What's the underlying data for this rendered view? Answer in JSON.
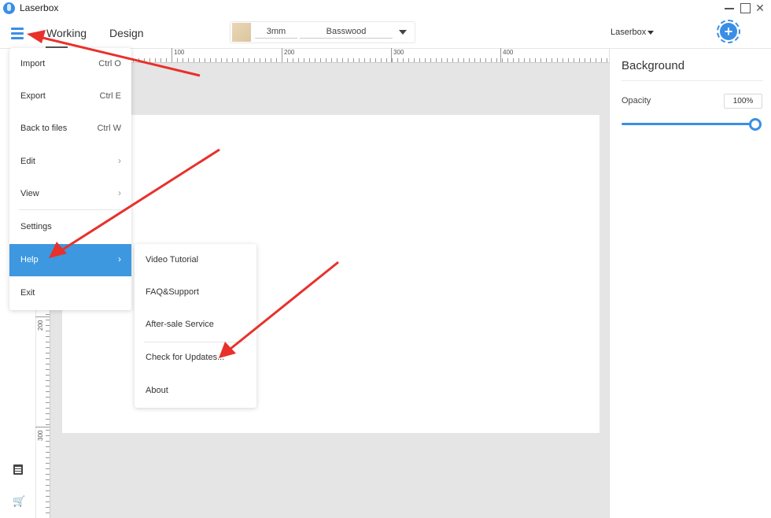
{
  "window": {
    "title": "Laserbox",
    "close_glyph": "✕"
  },
  "toolbar": {
    "menu_icon": "hamburger-menu-icon",
    "tabs": [
      {
        "label": "Working",
        "active": true
      },
      {
        "label": "Design",
        "active": false
      }
    ],
    "material": {
      "thickness": "3mm",
      "name": "Basswood"
    },
    "device": "Laserbox",
    "connect_icon": "plus-icon",
    "connect_glyph": "+"
  },
  "rulers": {
    "top_labels": [
      "100",
      "200",
      "300",
      "400"
    ],
    "left_labels": [
      "200",
      "300"
    ]
  },
  "sidebar": {
    "icons": [
      "note-icon",
      "cart-icon"
    ],
    "cart_glyph": "🛒"
  },
  "right_panel": {
    "title": "Background",
    "opacity_label": "Opacity",
    "opacity_value": "100%",
    "opacity_level": 1.0
  },
  "main_menu": {
    "items": [
      {
        "label": "Import",
        "shortcut": "Ctrl O"
      },
      {
        "label": "Export",
        "shortcut": "Ctrl E"
      },
      {
        "label": "Back to files",
        "shortcut": "Ctrl W"
      },
      {
        "label": "Edit",
        "arrow": "›"
      },
      {
        "label": "View",
        "arrow": "›"
      },
      {
        "label": "Settings"
      },
      {
        "label": "Help",
        "arrow": "›",
        "active": true
      },
      {
        "label": "Exit"
      }
    ]
  },
  "help_submenu": {
    "items": [
      {
        "label": "Video Tutorial"
      },
      {
        "label": "FAQ&Support"
      },
      {
        "label": "After-sale Service"
      },
      {
        "label": "Check for Updates..."
      },
      {
        "label": "About"
      }
    ]
  },
  "colors": {
    "accent": "#3a8ee6",
    "menu_active": "#3d98e0",
    "annotation_arrow": "#e8312b",
    "canvas_bg": "#e5e5e5"
  }
}
